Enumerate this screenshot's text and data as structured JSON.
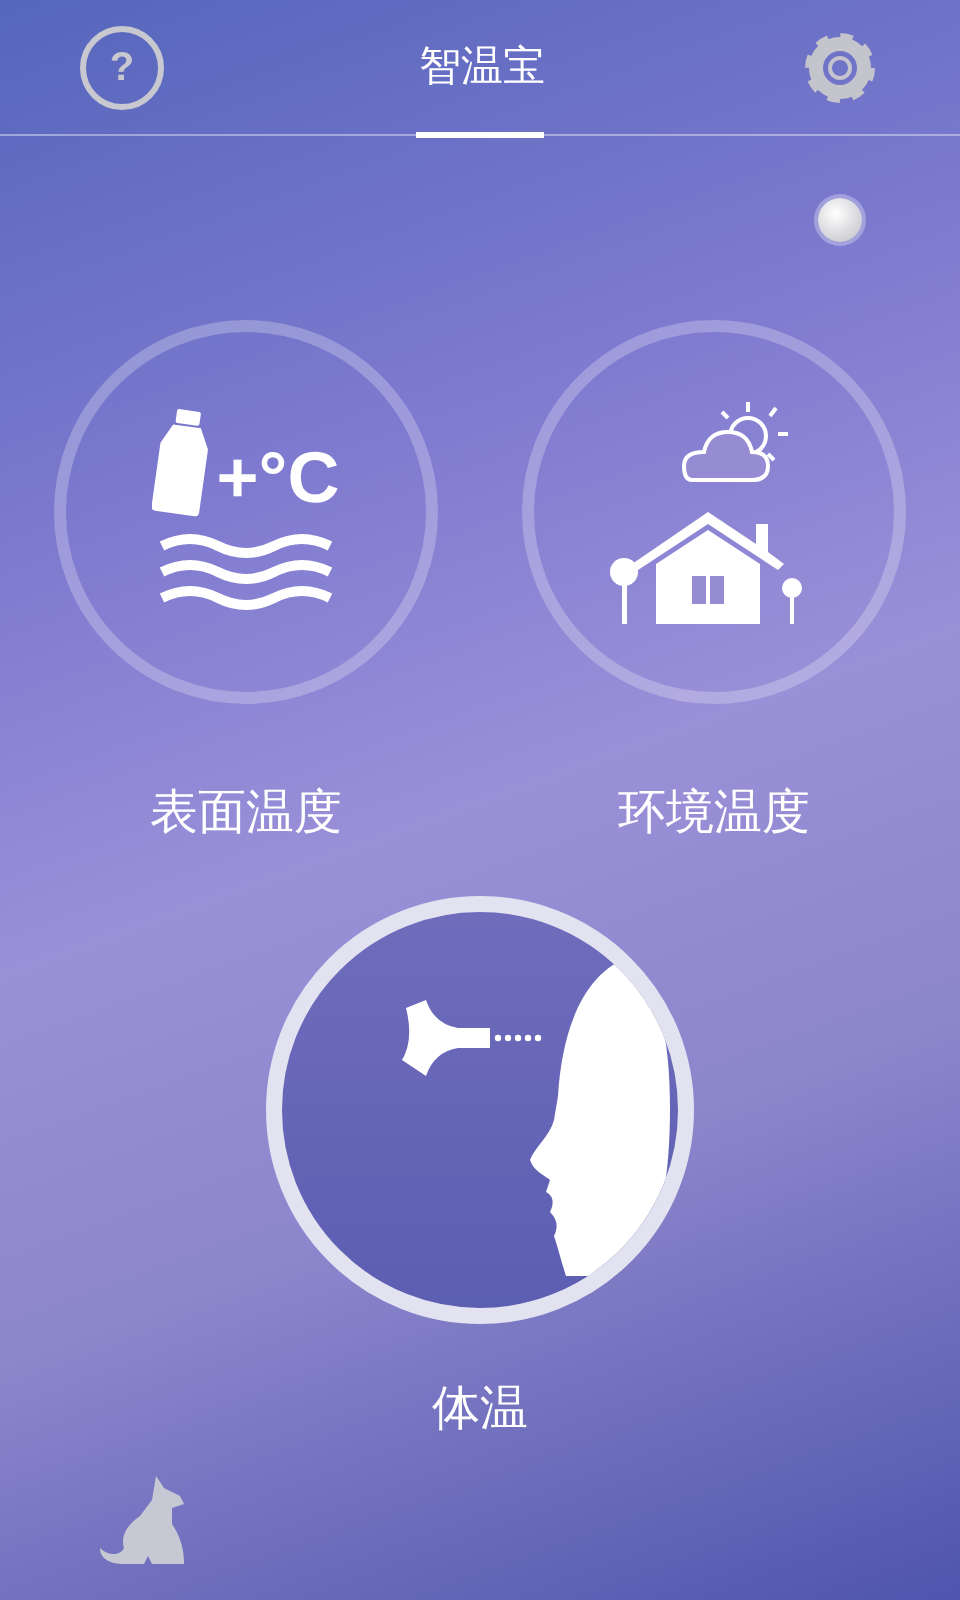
{
  "header": {
    "help_glyph": "?",
    "title": "智温宝"
  },
  "modes": [
    {
      "kind": "surface",
      "label": "表面温度",
      "icon_text": "+°C"
    },
    {
      "kind": "environment",
      "label": "环境温度"
    },
    {
      "kind": "body",
      "label": "体温"
    }
  ]
}
